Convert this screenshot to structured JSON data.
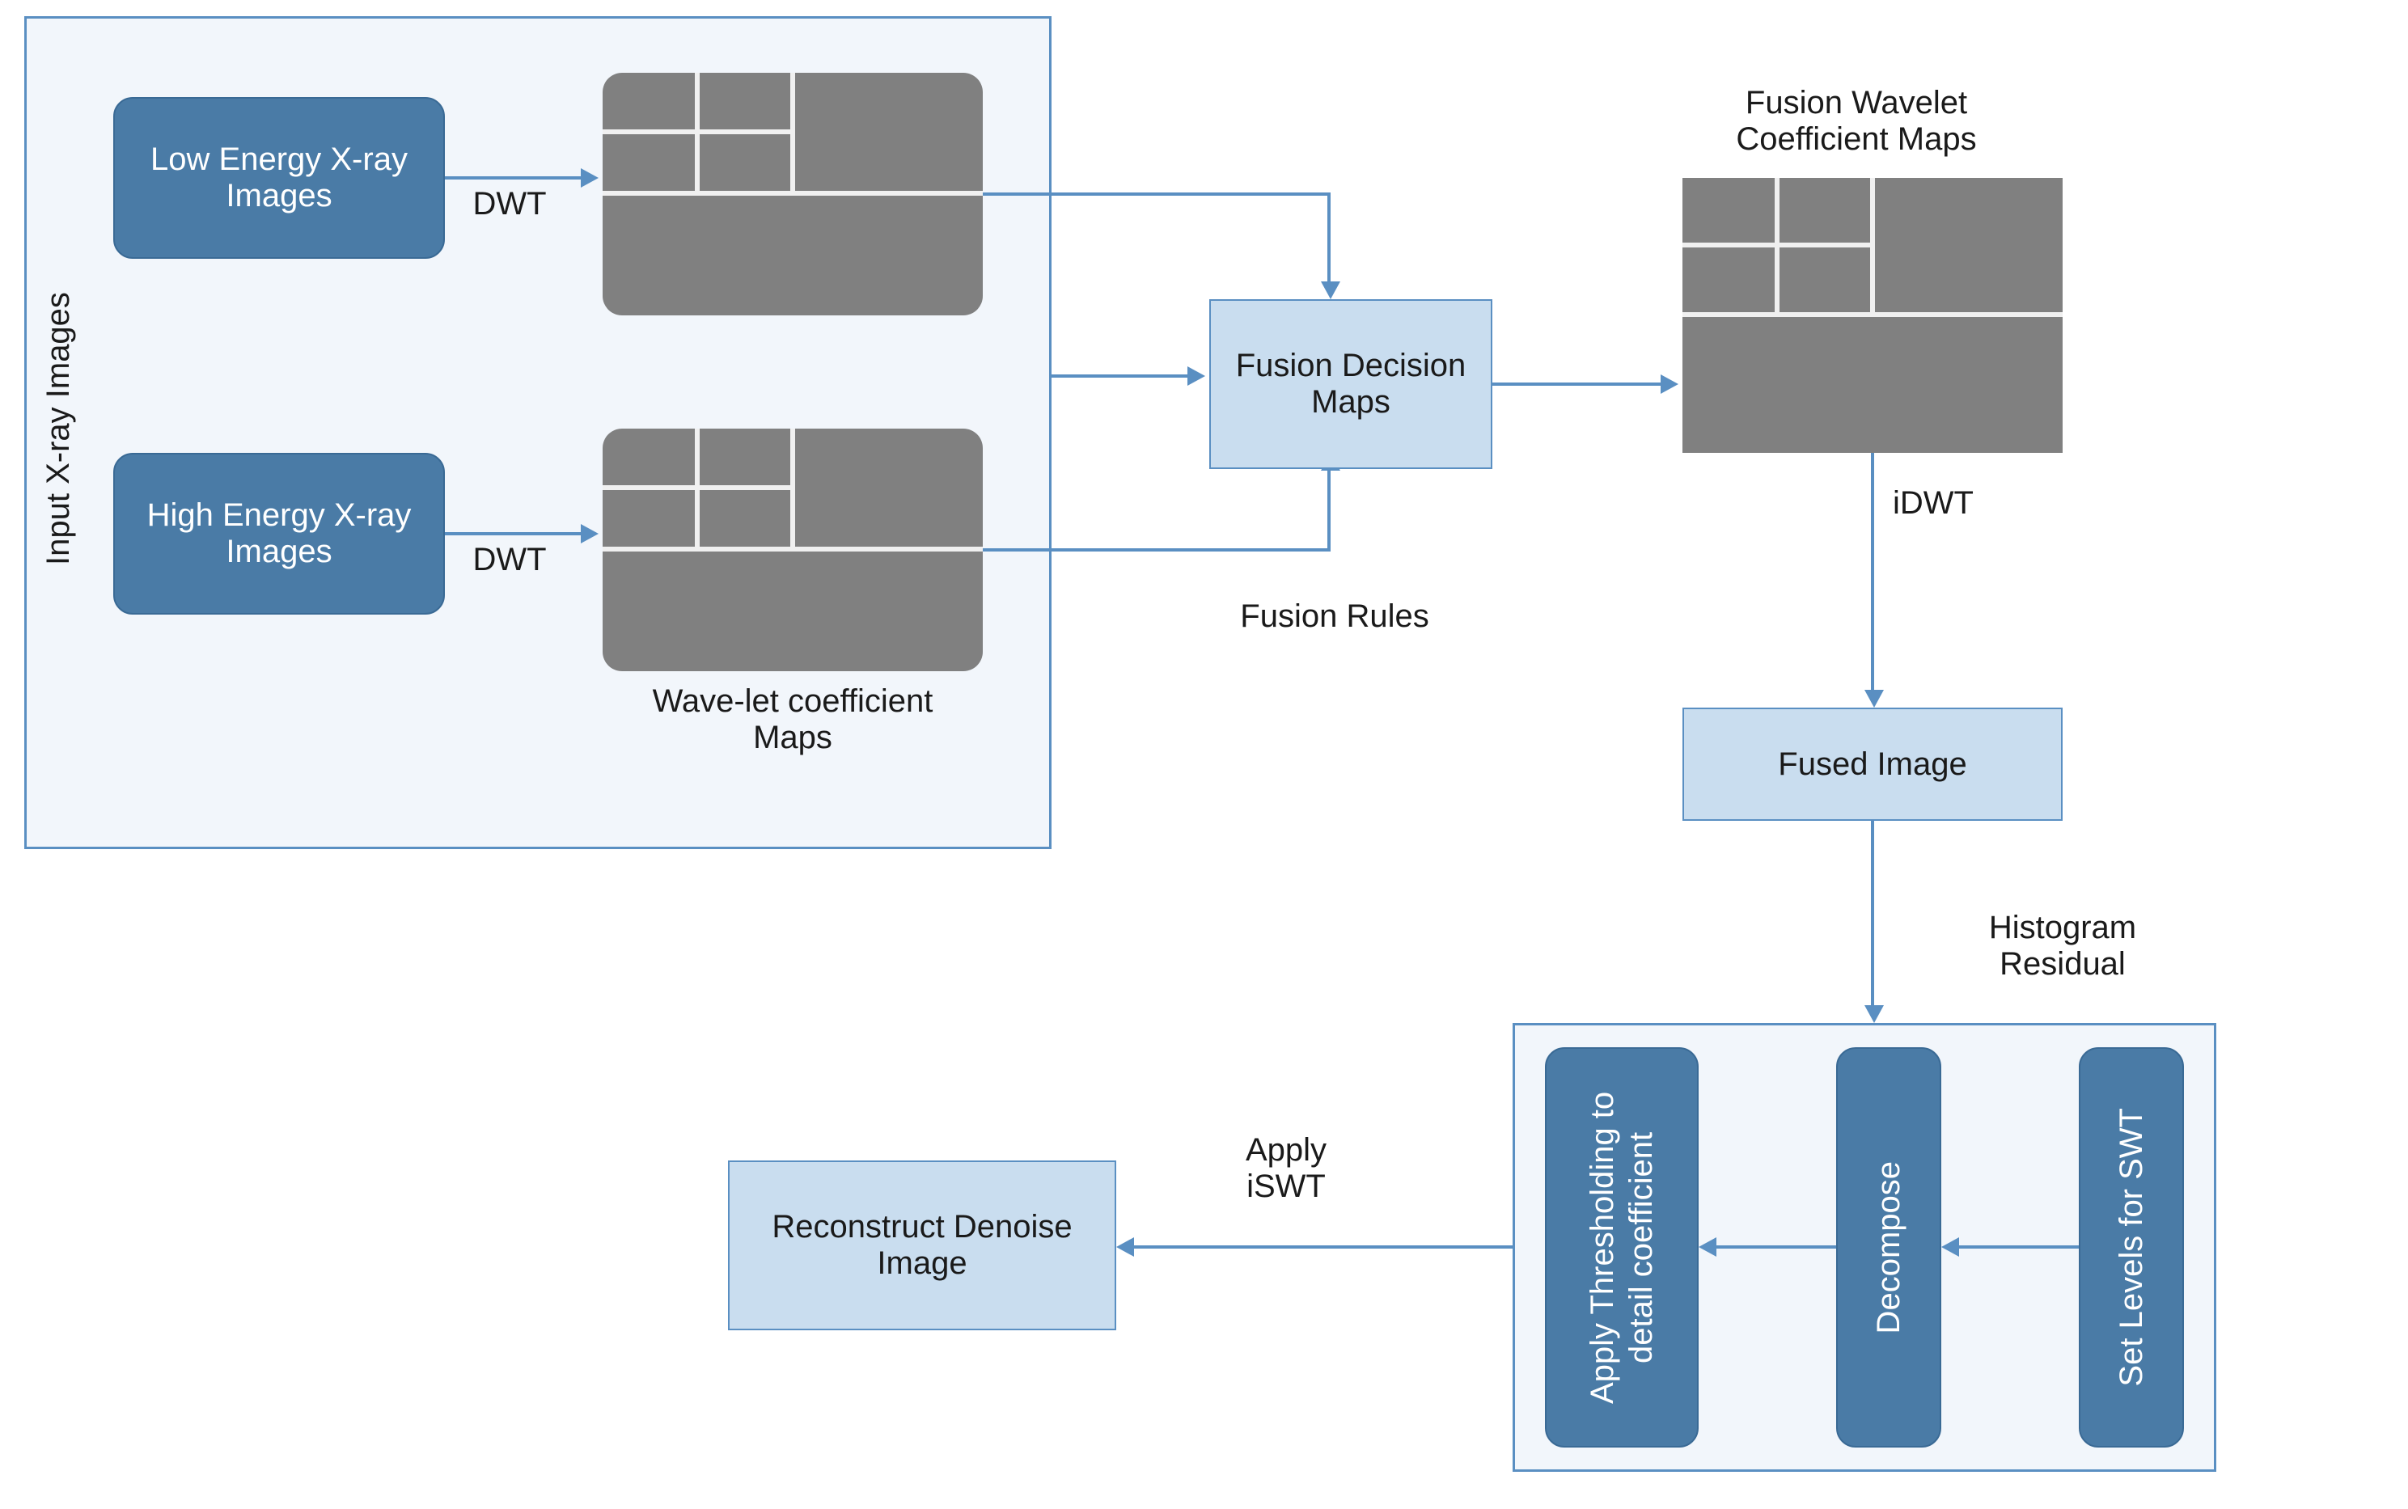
{
  "inputs": {
    "group_label": "Input X-ray Images",
    "low_energy": "Low Energy X-ray Images",
    "high_energy": "High Energy X-ray Images",
    "dwt_label_top": "DWT",
    "dwt_label_bottom": "DWT",
    "wavelet_maps_label": "Wave-let coefficient Maps"
  },
  "fusion": {
    "decision_maps": "Fusion Decision Maps",
    "rules_label": "Fusion Rules",
    "fusion_wavelet_label": "Fusion Wavelet Coefficient Maps",
    "idwt_label": "iDWT",
    "fused_image": "Fused Image"
  },
  "denoise": {
    "histogram_residual_label": "Histogram Residual",
    "set_levels": "Set Levels for SWT",
    "decompose": "Decompose",
    "thresholding": "Apply Thresholding to detail coefficient",
    "apply_iswt_label": "Apply iSWT",
    "reconstruct": "Reconstruct Denoise Image"
  }
}
